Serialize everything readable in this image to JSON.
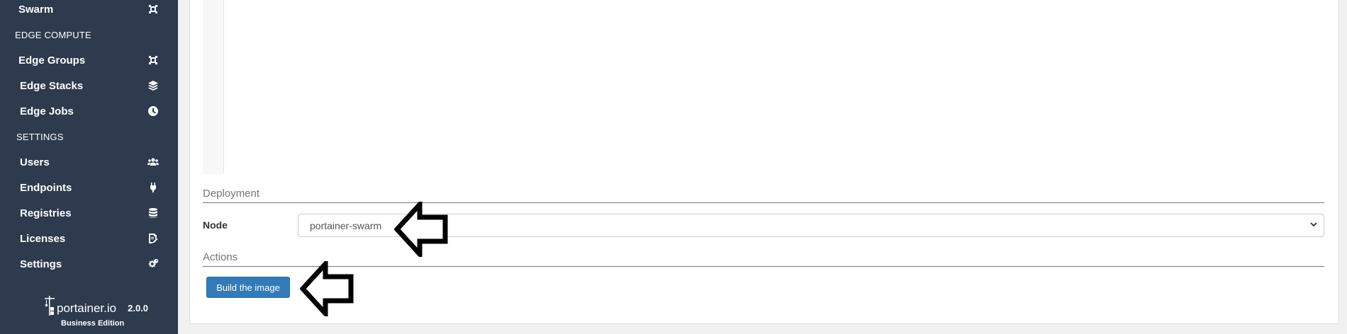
{
  "sidebar": {
    "items": [
      {
        "label": "Swarm",
        "icon": "swarm-icon"
      },
      {
        "label": "Edge Groups",
        "icon": "edge-groups-icon"
      },
      {
        "label": "Edge Stacks",
        "icon": "layers-icon"
      },
      {
        "label": "Edge Jobs",
        "icon": "clock-icon"
      },
      {
        "label": "Users",
        "icon": "users-icon"
      },
      {
        "label": "Endpoints",
        "icon": "plug-icon"
      },
      {
        "label": "Registries",
        "icon": "database-icon"
      },
      {
        "label": "Licenses",
        "icon": "license-edit-icon"
      },
      {
        "label": "Settings",
        "icon": "cogs-icon"
      }
    ],
    "headers": {
      "edge_compute": "EDGE COMPUTE",
      "settings": "SETTINGS"
    },
    "footer": {
      "logo_text": "portainer.io",
      "version": "2.0.0",
      "edition": "Business Edition"
    }
  },
  "main": {
    "deployment": {
      "title": "Deployment",
      "node_label": "Node",
      "node_value": "portainer-swarm"
    },
    "actions": {
      "title": "Actions",
      "build_label": "Build the image"
    }
  },
  "colors": {
    "sidebar_bg": "#2e3b4e",
    "primary_button": "#337ab7"
  }
}
